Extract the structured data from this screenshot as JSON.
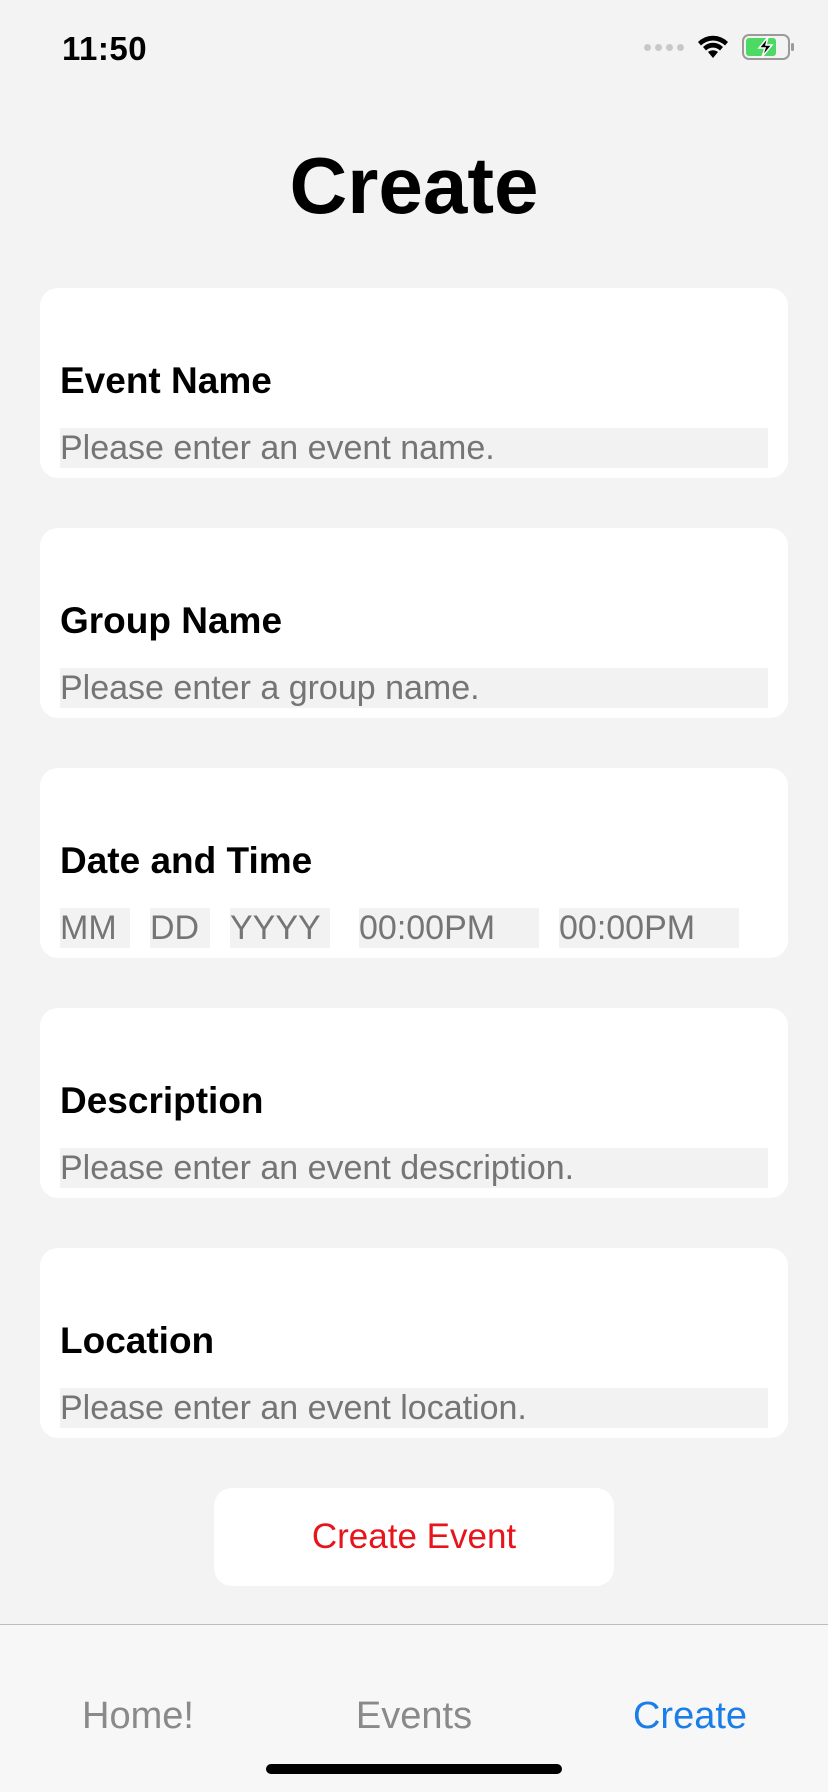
{
  "status_bar": {
    "time": "11:50"
  },
  "page": {
    "title": "Create"
  },
  "form": {
    "event_name": {
      "label": "Event Name",
      "placeholder": "Please enter an event name."
    },
    "group_name": {
      "label": "Group Name",
      "placeholder": "Please enter a group name."
    },
    "date_time": {
      "label": "Date and Time",
      "month_placeholder": "MM",
      "day_placeholder": "DD",
      "year_placeholder": "YYYY",
      "start_time_placeholder": "00:00PM",
      "end_time_placeholder": "00:00PM"
    },
    "description": {
      "label": "Description",
      "placeholder": "Please enter an event description."
    },
    "location": {
      "label": "Location",
      "placeholder": "Please enter an event location."
    }
  },
  "create_button": {
    "label": "Create Event"
  },
  "tabs": [
    {
      "label": "Home!",
      "active": false
    },
    {
      "label": "Events",
      "active": false
    },
    {
      "label": "Create",
      "active": true
    }
  ],
  "colors": {
    "accent": "#1a7ee6",
    "destructive": "#e8141c",
    "background": "#f3f3f3",
    "field": "#f2f2f2",
    "battery": "#4cd964"
  }
}
